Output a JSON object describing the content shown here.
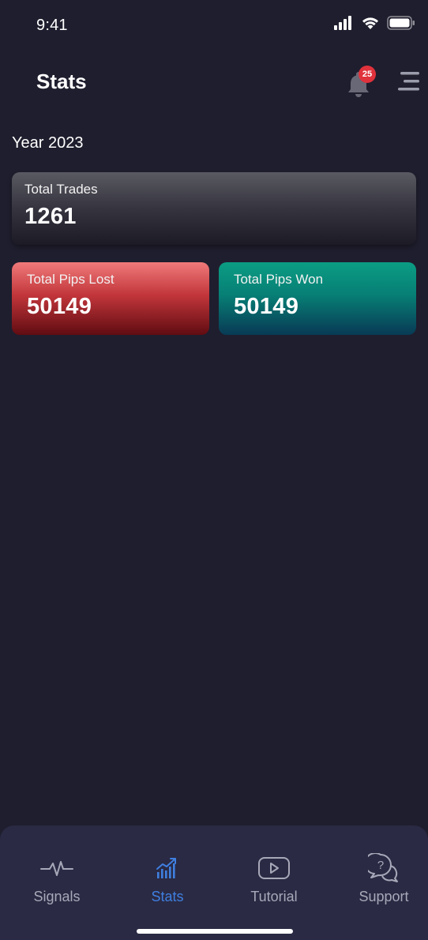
{
  "status_bar": {
    "time": "9:41",
    "icons": [
      "cellular-signal-icon",
      "wifi-icon",
      "battery-icon"
    ]
  },
  "header": {
    "title": "Stats",
    "notification_count": "25",
    "icons": [
      "bell-icon",
      "hamburger-menu-icon"
    ]
  },
  "year_label": "Year 2023",
  "cards": {
    "total_trades": {
      "label": "Total Trades",
      "value": "1261"
    },
    "pips_lost": {
      "label": "Total Pips Lost",
      "value": "50149"
    },
    "pips_won": {
      "label": "Total Pips Won",
      "value": "50149"
    }
  },
  "tabbar": {
    "tabs": [
      {
        "label": "Signals",
        "icon": "pulse-line-icon",
        "active": false
      },
      {
        "label": "Stats",
        "icon": "chart-up-icon",
        "active": true
      },
      {
        "label": "Tutorial",
        "icon": "play-button-icon",
        "active": false
      },
      {
        "label": "Support",
        "icon": "chat-question-icon",
        "active": false
      }
    ]
  },
  "colors": {
    "background": "#1f1e2e",
    "tabbar": "#2a2a44",
    "active_tab": "#3f7fe0",
    "inactive_tab": "#a7a8b8",
    "badge": "#e0323c",
    "lost_card": "#c2363b",
    "won_card": "#077f75"
  }
}
